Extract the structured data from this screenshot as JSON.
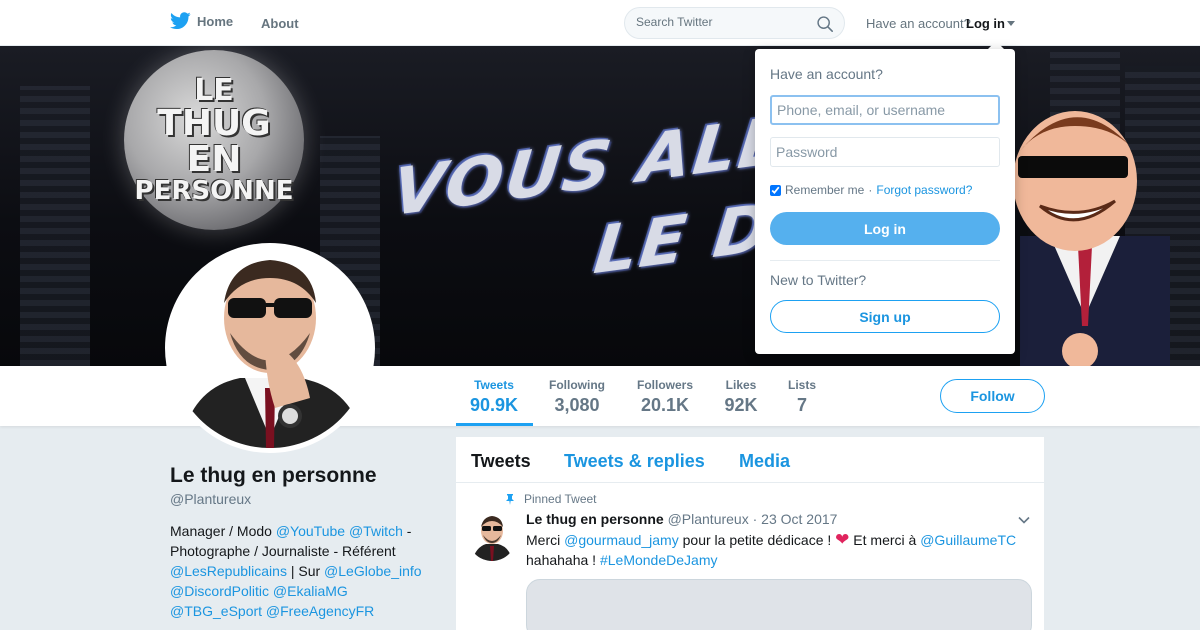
{
  "nav": {
    "home_label": "Home",
    "about_label": "About",
    "search_placeholder": "Search Twitter",
    "have_account": "Have an account?",
    "login_label": "Log in"
  },
  "banner": {
    "moon_lines": [
      "LE",
      "THUG",
      "EN",
      "PERSONNE"
    ],
    "slogan_line1": "VOUS ALLEZ AI",
    "slogan_line2": "LE DET"
  },
  "stats": [
    {
      "label": "Tweets",
      "value": "90.9K",
      "active": true
    },
    {
      "label": "Following",
      "value": "3,080"
    },
    {
      "label": "Followers",
      "value": "20.1K"
    },
    {
      "label": "Likes",
      "value": "92K"
    },
    {
      "label": "Lists",
      "value": "7"
    }
  ],
  "follow_label": "Follow",
  "profile": {
    "name": "Le thug en personne",
    "handle": "@Plantureux",
    "bio": {
      "yt": "@YouTube",
      "twitch": "@Twitch",
      "prefix": "Manager / Modo ",
      "mid": " - Photographe / Journaliste - Référent ",
      "lr": "@LesRepublicains",
      "sur": " | Sur ",
      "globe": "@LeGlobe_info",
      "discord": "@DiscordPolitic",
      "ekalia": "@EkaliaMG",
      "tbg": "@TBG_eSport",
      "fa": "@FreeAgencyFR"
    }
  },
  "timeline": {
    "tabs": [
      "Tweets",
      "Tweets & replies",
      "Media"
    ],
    "pinned_label": "Pinned Tweet",
    "tweet": {
      "author": "Le thug en personne",
      "handle": "@Plantureux",
      "date": "· 23 Oct 2017",
      "text_prefix": "Merci ",
      "mention1": "@gourmaud_jamy",
      "text_mid": " pour la petite dédicace ! ",
      "heart": "❤",
      "text_mid2": " Et merci à ",
      "mention2": "@GuillaumeTC",
      "text_end": " hahahaha ! ",
      "hashtag": "#LeMondeDeJamy"
    }
  },
  "login_dropdown": {
    "title": "Have an account?",
    "username_placeholder": "Phone, email, or username",
    "password_placeholder": "Password",
    "remember_label": "Remember me",
    "dot": "·",
    "forgot_label": "Forgot password?",
    "login_button": "Log in",
    "new_label": "New to Twitter?",
    "signup_button": "Sign up"
  },
  "colors": {
    "brand": "#1da1f2",
    "link": "#1b95e0",
    "page_bg": "#e6ecf0"
  },
  "icons": [
    "twitter-bird-icon",
    "search-icon",
    "pin-icon",
    "chevron-down-icon",
    "caret-down-icon"
  ]
}
